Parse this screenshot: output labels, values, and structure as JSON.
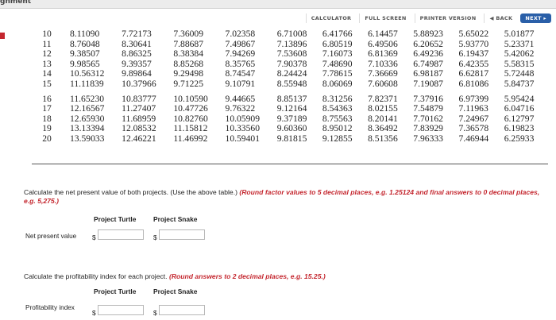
{
  "window": {
    "title": "gnment"
  },
  "toolbar": {
    "calculator": "CALCULATOR",
    "full_screen": "FULL SCREEN",
    "printer_version": "PRINTER VERSION",
    "back": "◀ BACK",
    "next": "NEXT ▸"
  },
  "factor_table": {
    "rows": [
      {
        "period": "10",
        "values": [
          "8.11090",
          "7.72173",
          "7.36009",
          "7.02358",
          "6.71008",
          "6.41766",
          "6.14457",
          "5.88923",
          "5.65022",
          "5.01877"
        ]
      },
      {
        "period": "11",
        "values": [
          "8.76048",
          "8.30641",
          "7.88687",
          "7.49867",
          "7.13896",
          "6.80519",
          "6.49506",
          "6.20652",
          "5.93770",
          "5.23371"
        ]
      },
      {
        "period": "12",
        "values": [
          "9.38507",
          "8.86325",
          "8.38384",
          "7.94269",
          "7.53608",
          "7.16073",
          "6.81369",
          "6.49236",
          "6.19437",
          "5.42062"
        ]
      },
      {
        "period": "13",
        "values": [
          "9.98565",
          "9.39357",
          "8.85268",
          "8.35765",
          "7.90378",
          "7.48690",
          "7.10336",
          "6.74987",
          "6.42355",
          "5.58315"
        ]
      },
      {
        "period": "14",
        "values": [
          "10.56312",
          "9.89864",
          "9.29498",
          "8.74547",
          "8.24424",
          "7.78615",
          "7.36669",
          "6.98187",
          "6.62817",
          "5.72448"
        ]
      },
      {
        "period": "15",
        "values": [
          "11.11839",
          "10.37966",
          "9.71225",
          "9.10791",
          "8.55948",
          "8.06069",
          "7.60608",
          "7.19087",
          "6.81086",
          "5.84737"
        ]
      },
      {
        "period": "16",
        "values": [
          "11.65230",
          "10.83777",
          "10.10590",
          "9.44665",
          "8.85137",
          "8.31256",
          "7.82371",
          "7.37916",
          "6.97399",
          "5.95424"
        ]
      },
      {
        "period": "17",
        "values": [
          "12.16567",
          "11.27407",
          "10.47726",
          "9.76322",
          "9.12164",
          "8.54363",
          "8.02155",
          "7.54879",
          "7.11963",
          "6.04716"
        ]
      },
      {
        "period": "18",
        "values": [
          "12.65930",
          "11.68959",
          "10.82760",
          "10.05909",
          "9.37189",
          "8.75563",
          "8.20141",
          "7.70162",
          "7.24967",
          "6.12797"
        ]
      },
      {
        "period": "19",
        "values": [
          "13.13394",
          "12.08532",
          "11.15812",
          "10.33560",
          "9.60360",
          "8.95012",
          "8.36492",
          "7.83929",
          "7.36578",
          "6.19823"
        ]
      },
      {
        "period": "20",
        "values": [
          "13.59033",
          "12.46221",
          "11.46992",
          "10.59401",
          "9.81815",
          "9.12855",
          "8.51356",
          "7.96333",
          "7.46944",
          "6.25933"
        ]
      }
    ]
  },
  "npv_question": {
    "text": "Calculate the net present value of both projects. (Use the above table.)",
    "note": "(Round factor values to 5 decimal places, e.g. 1.25124 and final answers to 0 decimal places, e.g. 5,275.)",
    "col_turtle": "Project Turtle",
    "col_snake": "Project Snake",
    "row_label": "Net present value",
    "currency": "$",
    "turtle_value": "",
    "snake_value": ""
  },
  "pi_question": {
    "text": "Calculate the profitability index for each project.",
    "note": "(Round answers to 2 decimal places, e.g. 15.25.)",
    "col_turtle": "Project Turtle",
    "col_snake": "Project Snake",
    "row_label": "Profitability index",
    "currency": "$",
    "turtle_value": "",
    "snake_value": ""
  }
}
